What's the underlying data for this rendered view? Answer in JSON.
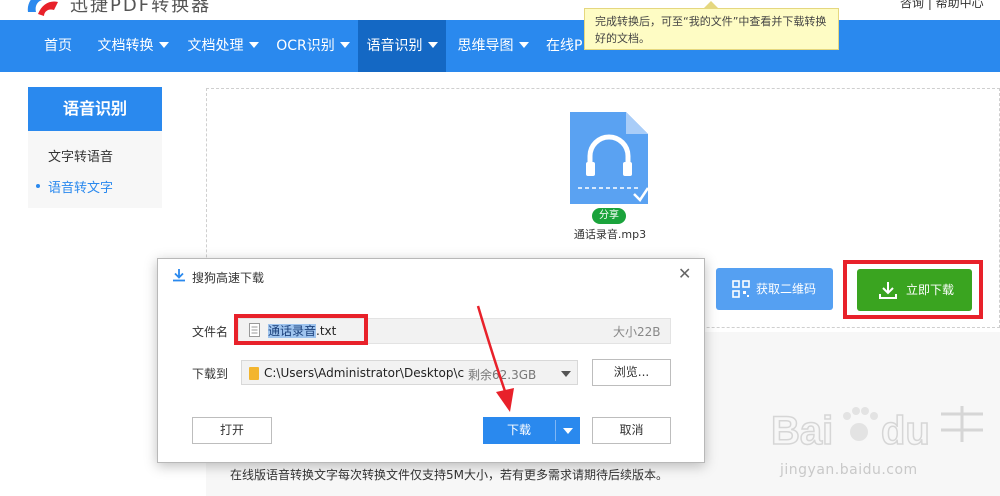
{
  "header": {
    "logo_text": "迅捷PDF转换器",
    "top_right": "咨询 | 帮助中心"
  },
  "nav": {
    "items": [
      {
        "label": "首页",
        "has_caret": false
      },
      {
        "label": "文档转换",
        "has_caret": true
      },
      {
        "label": "文档处理",
        "has_caret": true
      },
      {
        "label": "OCR识别",
        "has_caret": true
      },
      {
        "label": "语音识别",
        "has_caret": true,
        "active": true
      },
      {
        "label": "思维导图",
        "has_caret": true
      },
      {
        "label": "在线P",
        "has_caret": false
      }
    ]
  },
  "tooltip": {
    "text": "完成转换后，可至“我的文件”中查看并下载转换好的文档。"
  },
  "sidebar": {
    "title": "语音识别",
    "items": [
      {
        "label": "文字转语音",
        "active": false
      },
      {
        "label": "语音转文字",
        "active": true
      }
    ]
  },
  "file": {
    "share_label": "分享",
    "name": "通话录音.mp3"
  },
  "actions": {
    "qr_label": "获取二维码",
    "download_label": "立即下载"
  },
  "note": "在线版语音转换文字每次转换文件仅支持5M大小，若有更多需求请期待后续版本。",
  "dialog": {
    "title": "搜狗高速下载",
    "filename_label": "文件名",
    "filename_selected": "通话录音",
    "filename_ext": ".txt",
    "size": "大小22B",
    "saveto_label": "下载到",
    "path": "C:\\Users\\Administrator\\Desktop\\che",
    "free_space": "剩余62.3GB",
    "browse_label": "浏览...",
    "open_label": "打开",
    "download_label": "下载",
    "cancel_label": "取消"
  },
  "watermark": {
    "url": "jingyan.baidu.com"
  },
  "colors": {
    "nav_blue": "#2a89ee",
    "nav_active": "#1468c4",
    "green": "#3aa420",
    "red_annotation": "#e8212a"
  }
}
